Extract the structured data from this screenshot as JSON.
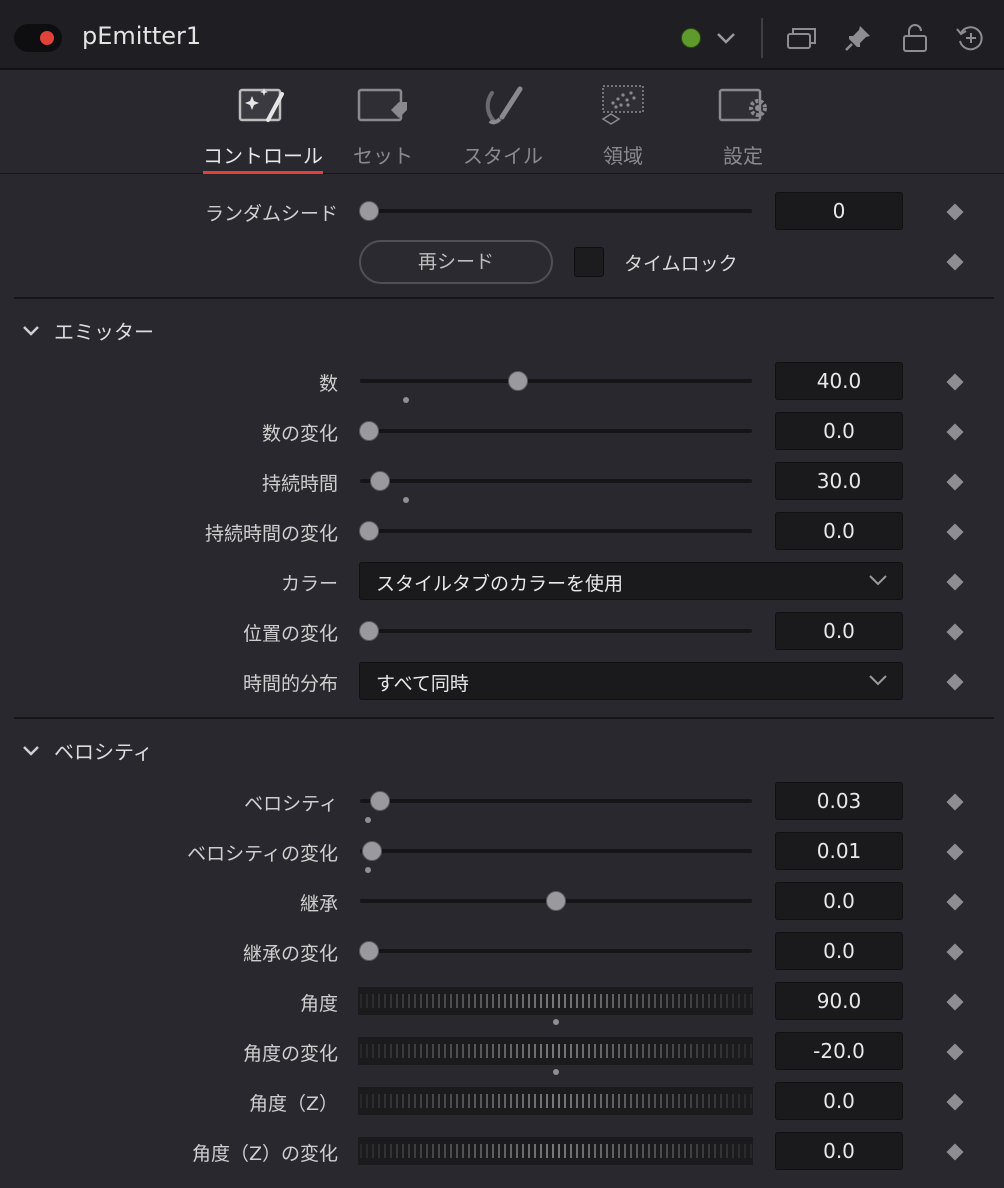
{
  "header": {
    "node_name": "pEmitter1"
  },
  "tabs": [
    {
      "label": "コントロール",
      "active": true
    },
    {
      "label": "セット"
    },
    {
      "label": "スタイル"
    },
    {
      "label": "領域"
    },
    {
      "label": "設定"
    }
  ],
  "top": {
    "random_seed": {
      "label": "ランダムシード",
      "value": "0"
    },
    "reseed_button": "再シード",
    "timelock_label": "タイムロック"
  },
  "emitter": {
    "title": "エミッター",
    "number": {
      "label": "数",
      "value": "40.0"
    },
    "number_variance": {
      "label": "数の変化",
      "value": "0.0"
    },
    "lifespan": {
      "label": "持続時間",
      "value": "30.0"
    },
    "lifespan_variance": {
      "label": "持続時間の変化",
      "value": "0.0"
    },
    "color": {
      "label": "カラー",
      "value": "スタイルタブのカラーを使用"
    },
    "position_variance": {
      "label": "位置の変化",
      "value": "0.0"
    },
    "temporal_distribution": {
      "label": "時間的分布",
      "value": "すべて同時"
    }
  },
  "velocity": {
    "title": "ベロシティ",
    "velocity": {
      "label": "ベロシティ",
      "value": "0.03"
    },
    "velocity_variance": {
      "label": "ベロシティの変化",
      "value": "0.01"
    },
    "inherit": {
      "label": "継承",
      "value": "0.0"
    },
    "inherit_variance": {
      "label": "継承の変化",
      "value": "0.0"
    },
    "angle": {
      "label": "角度",
      "value": "90.0"
    },
    "angle_variance": {
      "label": "角度の変化",
      "value": "-20.0"
    },
    "angle_z": {
      "label": "角度（Z）",
      "value": "0.0"
    },
    "angle_z_variance": {
      "label": "角度（Z）の変化",
      "value": "0.0"
    }
  },
  "colors": {
    "accent": "#e0423a",
    "status_green": "#5e9a2c",
    "panel_bg": "#28282e"
  }
}
